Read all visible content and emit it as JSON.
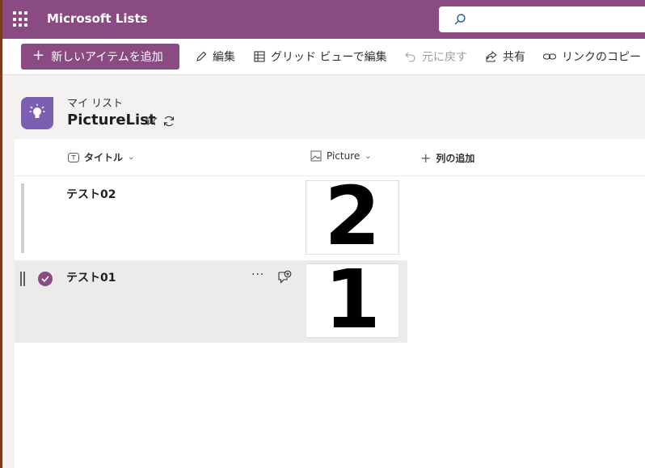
{
  "app": {
    "name": "Microsoft Lists"
  },
  "search": {
    "placeholder": ""
  },
  "commands": {
    "new_item": "新しいアイテムを追加",
    "edit": "編集",
    "grid_edit": "グリッド ビューで編集",
    "undo": "元に戻す",
    "share": "共有",
    "copy_link": "リンクのコピー"
  },
  "list": {
    "breadcrumb": "マイ リスト",
    "title": "PictureList"
  },
  "columns": {
    "title": "タイトル",
    "picture": "Picture",
    "add": "列の追加"
  },
  "rows": [
    {
      "title": "テスト02",
      "picture": "2",
      "selected": false
    },
    {
      "title": "テスト01",
      "picture": "1",
      "selected": true
    }
  ],
  "colors": {
    "brand": "#8a4b82",
    "list_icon": "#7c5fb0"
  }
}
